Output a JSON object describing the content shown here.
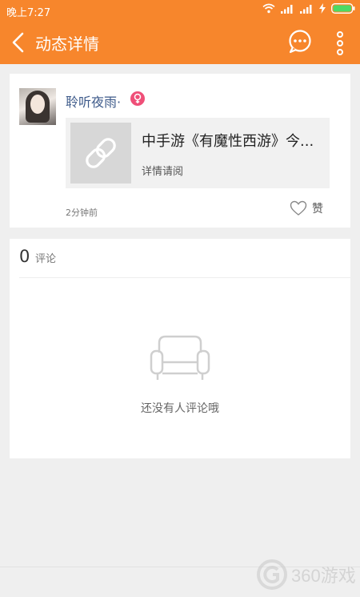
{
  "status_bar": {
    "time": "晚上7:27"
  },
  "header": {
    "title": "动态详情"
  },
  "post": {
    "username": "聆听夜雨·",
    "link_title": "中手游《有魔性西游》今...",
    "link_subtitle": "详情请阅",
    "time_ago": "2分钟前",
    "like_label": "赞"
  },
  "comments": {
    "count": "0",
    "label": "评论",
    "empty_text": "还没有人评论哦"
  },
  "watermark": {
    "text": "360游戏"
  },
  "colors": {
    "accent": "#f7862c",
    "username": "#3d5a8a",
    "female_badge": "#ef4f78"
  }
}
